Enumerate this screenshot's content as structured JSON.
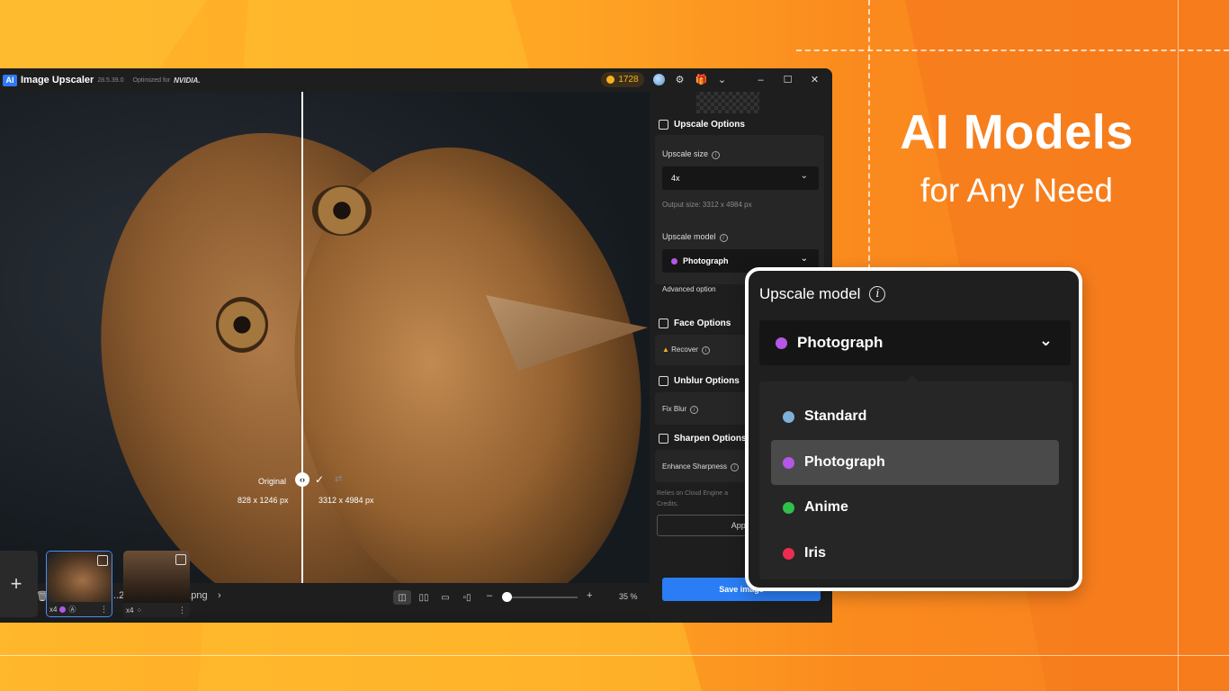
{
  "headline": {
    "line1": "AI Models",
    "line2": "for Any Need"
  },
  "window": {
    "logo": "AI",
    "app_name": "Image Upscaler",
    "version": "28.5.39.0",
    "optimized_for": "Optimized for",
    "nvidia": "NVIDIA.",
    "credits": "1728",
    "icons": [
      "avatar",
      "sliders-icon",
      "gift-icon",
      "chevron-down-icon",
      "minimize-icon",
      "maximize-icon",
      "close-icon"
    ]
  },
  "canvas": {
    "label_original": "Original",
    "size_original": "828 x 1246 px",
    "size_upscaled": "3312 x 4984 px"
  },
  "bottombar": {
    "filename": "...260302-102557.png",
    "zoom": "35 %"
  },
  "thumbnails": [
    {
      "scale": "x4",
      "selected": true
    },
    {
      "scale": "x4",
      "selected": false
    }
  ],
  "panel": {
    "upscale_options": "Upscale Options",
    "upscale_size_label": "Upscale size",
    "upscale_size_value": "4x",
    "output_size": "Output size: 3312 x 4984 px",
    "upscale_model_label": "Upscale model",
    "upscale_model_value": "Photograph",
    "advanced_option": "Advanced option",
    "face_options": "Face Options",
    "recover": "Recover",
    "unblur_options": "Unblur Options",
    "fix_blur": "Fix Blur",
    "sharpen_options": "Sharpen Options",
    "enhance_sharpness": "Enhance Sharpness",
    "cloud_note_1": "Relies on Cloud Engine a",
    "cloud_note_2": "Credits.",
    "apply": "Apply",
    "save_image": "Save image"
  },
  "popup": {
    "title": "Upscale model",
    "selected": "Photograph",
    "selected_color": "#b557e6",
    "options": [
      {
        "label": "Standard",
        "color": "#7fb0d8"
      },
      {
        "label": "Photograph",
        "color": "#b557e6"
      },
      {
        "label": "Anime",
        "color": "#2fbf4a"
      },
      {
        "label": "Iris",
        "color": "#ec2d4f"
      }
    ]
  },
  "colors": {
    "accent": "#2a7df4",
    "background": "#f98a1e",
    "app_bg": "#1c1c1c"
  }
}
